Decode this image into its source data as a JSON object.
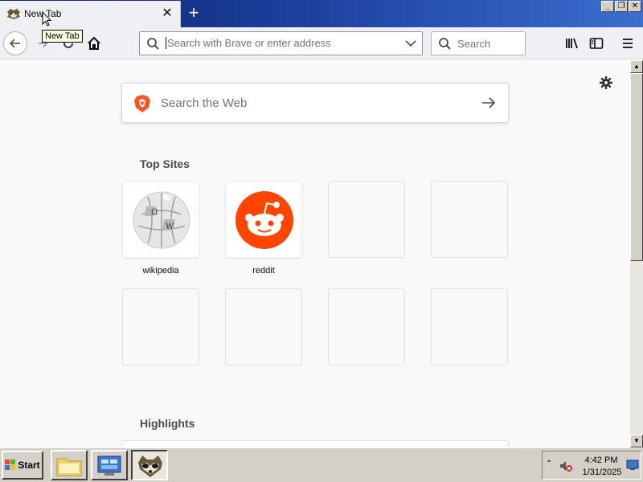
{
  "browser": {
    "tab_title": "New Tab",
    "tab_tooltip": "New Tab",
    "urlbar_placeholder": "Search with Brave or enter address",
    "searchbar_placeholder": "Search"
  },
  "newtab": {
    "websearch_placeholder": "Search the Web",
    "top_sites_title": "Top Sites",
    "top_sites": [
      {
        "label": "wikipedia"
      },
      {
        "label": "reddit"
      }
    ],
    "highlights_title": "Highlights"
  },
  "taskbar": {
    "start_label": "Start",
    "clock_time": "4:42 PM",
    "clock_date": "1/31/2025"
  },
  "colors": {
    "titlebar": "#0a246a",
    "reddit": "#ff4500",
    "brave": "#fb542b"
  }
}
